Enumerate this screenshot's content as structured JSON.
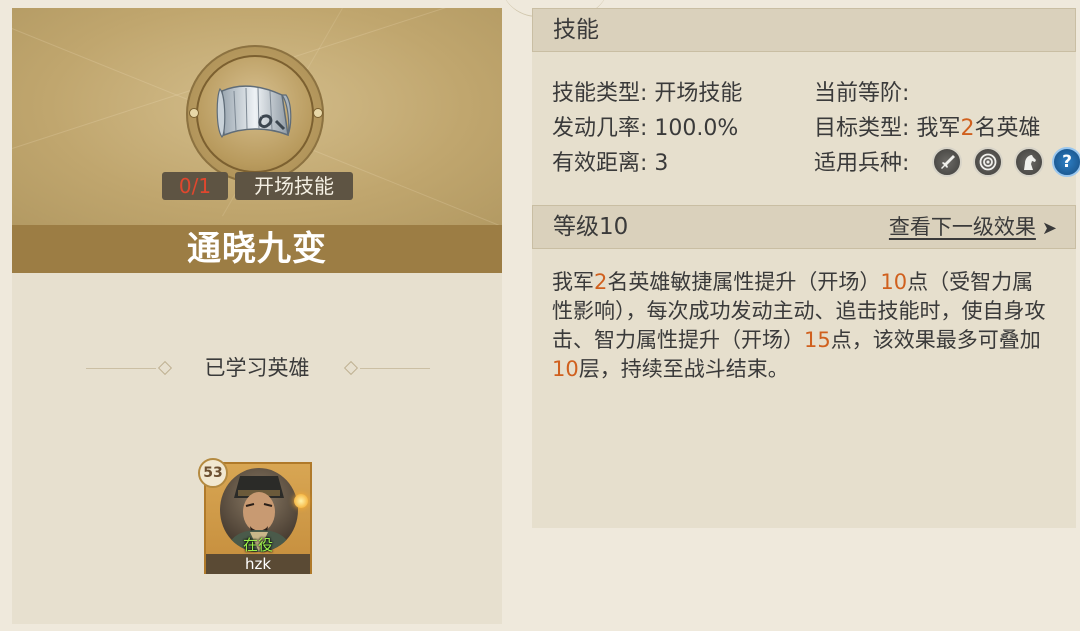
{
  "skill_card": {
    "count": "0/1",
    "type_badge": "开场技能",
    "name": "通晓九变"
  },
  "learned": {
    "title": "已学习英雄",
    "heroes": [
      {
        "level": "53",
        "status": "在役",
        "name": "hzk"
      }
    ]
  },
  "skill_section": {
    "title": "技能",
    "rows": {
      "type_label": "技能类型:",
      "type_value": "开场技能",
      "rate_label": "发动几率:",
      "rate_value": "100.0%",
      "range_label": "有效距离:",
      "range_value": "3",
      "grade_label": "当前等阶:",
      "target_label": "目标类型:",
      "target_prefix": "我军",
      "target_num": "2",
      "target_suffix": "名英雄",
      "troop_label": "适用兵种:"
    },
    "troop_icons": [
      "sword-icon",
      "target-icon",
      "horse-icon",
      "question-icon"
    ]
  },
  "level_section": {
    "title": "等级10",
    "next_link": "查看下一级效果",
    "description_parts": [
      {
        "text": "我军",
        "hl": false
      },
      {
        "text": "2",
        "hl": true
      },
      {
        "text": "名英雄敏捷属性提升（开场）",
        "hl": false
      },
      {
        "text": "10",
        "hl": true
      },
      {
        "text": "点（受智力属性影响），每次成功发动主动、追击技能时，使自身攻击、智力属性提升（开场）",
        "hl": false
      },
      {
        "text": "15",
        "hl": true
      },
      {
        "text": "点，该效果最多可叠加",
        "hl": false
      },
      {
        "text": "10",
        "hl": true
      },
      {
        "text": "层，持续至战斗结束。",
        "hl": false
      }
    ]
  },
  "colors": {
    "highlight": "#d0601e",
    "count_red": "#e0472e",
    "name_bar": "#9c7d44",
    "status_green": "#9cf04c"
  }
}
